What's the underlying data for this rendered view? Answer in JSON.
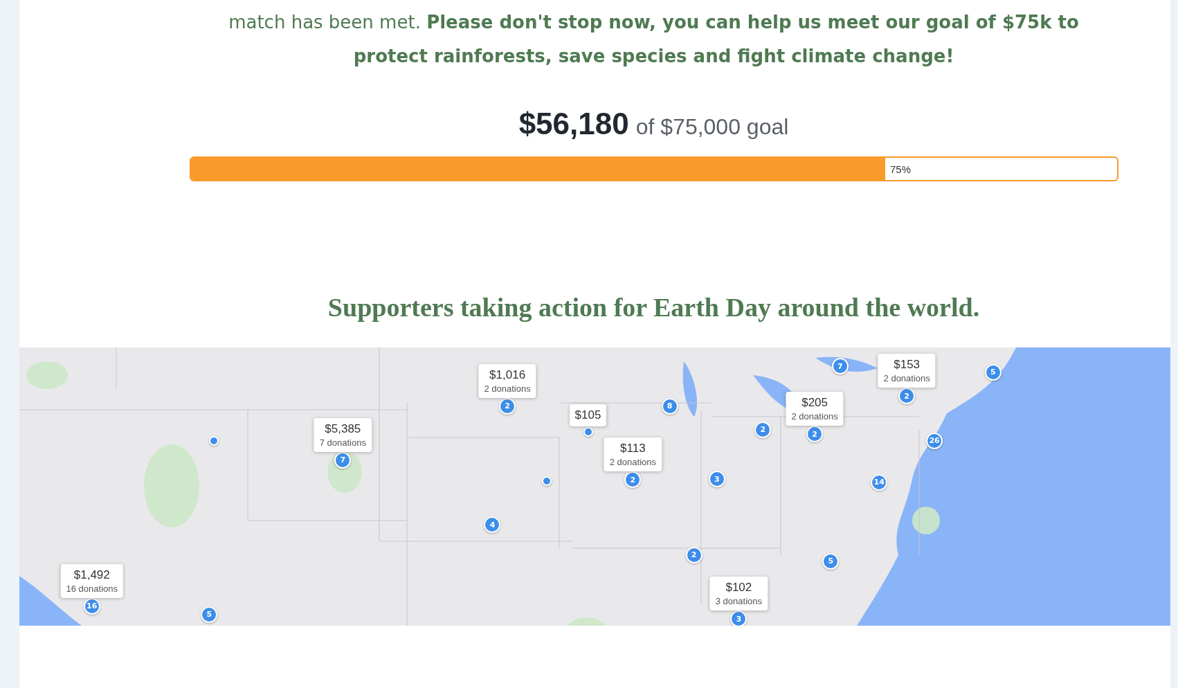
{
  "appeal": {
    "text": "match has been met. **Please don't stop now, you can help us meet our goal of $75k to protect rainforests, save species and fight climate change!**"
  },
  "progress": {
    "raised": "$56,180",
    "goal": "of $75,000 goal",
    "level": 0.75,
    "percent": "75%"
  },
  "map_section": {
    "title": "Supporters taking action for Earth Day around the world.",
    "markers": [
      {
        "kind": "cluster",
        "count": "16",
        "popup": {
          "amount": "$1,492",
          "donations": "16 donations"
        }
      },
      {
        "kind": "cluster",
        "count": "5"
      },
      {
        "kind": "dot"
      },
      {
        "kind": "cluster",
        "count": "7",
        "popup": {
          "amount": "$5,385",
          "donations": "7 donations"
        }
      },
      {
        "kind": "cluster",
        "count": "2",
        "popup": {
          "amount": "$1,016",
          "donations": "2 donations"
        }
      },
      {
        "kind": "dot",
        "popup": {
          "amount": "$105"
        }
      },
      {
        "kind": "cluster",
        "count": "4"
      },
      {
        "kind": "dot"
      },
      {
        "kind": "cluster",
        "count": "2",
        "popup": {
          "amount": "$113",
          "donations": "2 donations"
        }
      },
      {
        "kind": "cluster",
        "count": "8"
      },
      {
        "kind": "cluster",
        "count": "3"
      },
      {
        "kind": "cluster",
        "count": "2"
      },
      {
        "kind": "cluster",
        "count": "3",
        "popup": {
          "amount": "$102",
          "donations": "3 donations"
        }
      },
      {
        "kind": "cluster",
        "count": "2"
      },
      {
        "kind": "cluster",
        "count": "2",
        "popup": {
          "amount": "$205",
          "donations": "2 donations"
        }
      },
      {
        "kind": "cluster",
        "count": "7"
      },
      {
        "kind": "cluster",
        "count": "2",
        "popup": {
          "amount": "$153",
          "donations": "2 donations"
        }
      },
      {
        "kind": "cluster",
        "count": "5"
      },
      {
        "kind": "cluster",
        "count": "26"
      },
      {
        "kind": "cluster",
        "count": "14"
      },
      {
        "kind": "cluster",
        "count": "5"
      }
    ]
  }
}
